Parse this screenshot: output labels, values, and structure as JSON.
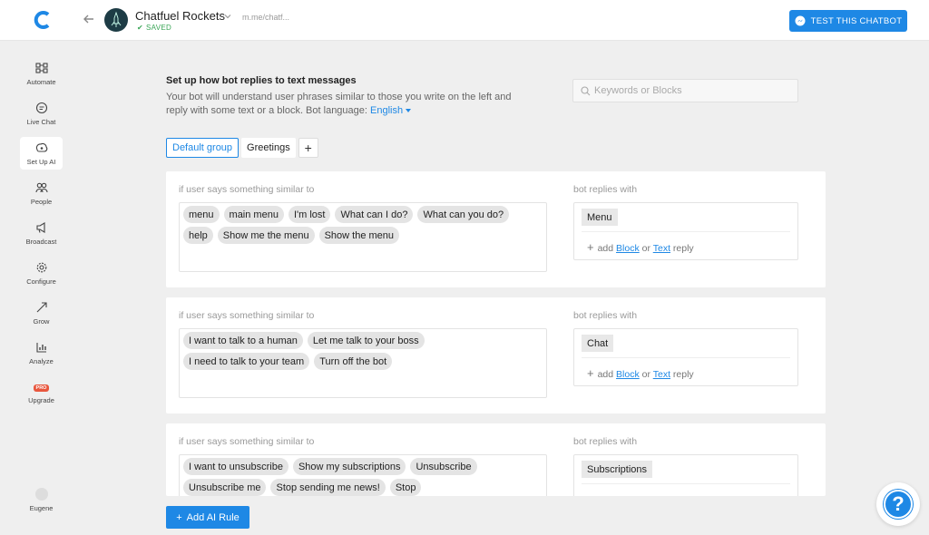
{
  "header": {
    "bot_name": "Chatfuel Rockets",
    "status": "SAVED",
    "bot_link": "m.me/chatf...",
    "test_button": "TEST THIS CHATBOT"
  },
  "sidebar": {
    "items": [
      {
        "label": "Automate",
        "icon": "automate-icon"
      },
      {
        "label": "Live Chat",
        "icon": "live-chat-icon"
      },
      {
        "label": "Set Up AI",
        "icon": "ai-icon",
        "active": true
      },
      {
        "label": "People",
        "icon": "people-icon"
      },
      {
        "label": "Broadcast",
        "icon": "broadcast-icon"
      },
      {
        "label": "Configure",
        "icon": "gear-icon"
      },
      {
        "label": "Grow",
        "icon": "grow-icon"
      },
      {
        "label": "Analyze",
        "icon": "analyze-icon"
      },
      {
        "label": "Upgrade",
        "icon": "pro-badge",
        "badge": "PRO"
      }
    ],
    "user": "Eugene"
  },
  "main": {
    "title": "Set up how bot replies to text messages",
    "description": "Your bot will understand user phrases similar to those you write on the left and reply with some text or a block. Bot language:",
    "language": "English",
    "search_placeholder": "Keywords or Blocks",
    "tabs": [
      "Default group",
      "Greetings"
    ],
    "user_label": "if user says something similar to",
    "bot_label": "bot replies with",
    "add_reply": {
      "prefix": "add",
      "block": "Block",
      "or": "or",
      "text": "Text",
      "suffix": "reply"
    },
    "rules": [
      {
        "phrases": [
          "menu",
          "main menu",
          "I'm lost",
          "What can I do?",
          "What can you do?",
          "help",
          "Show me the menu",
          "Show the menu"
        ],
        "reply": "Menu"
      },
      {
        "phrases": [
          "I want to talk to a human",
          "Let me talk to your boss",
          "I need to talk to your team",
          "Turn off the bot"
        ],
        "reply": "Chat"
      },
      {
        "phrases": [
          "I want to unsubscribe",
          "Show my subscriptions",
          "Unsubscribe",
          "Unsubscribe me",
          "Stop sending me news!",
          "Stop"
        ],
        "reply": "Subscriptions"
      }
    ],
    "add_rule_button": "Add AI Rule"
  },
  "help": "?"
}
